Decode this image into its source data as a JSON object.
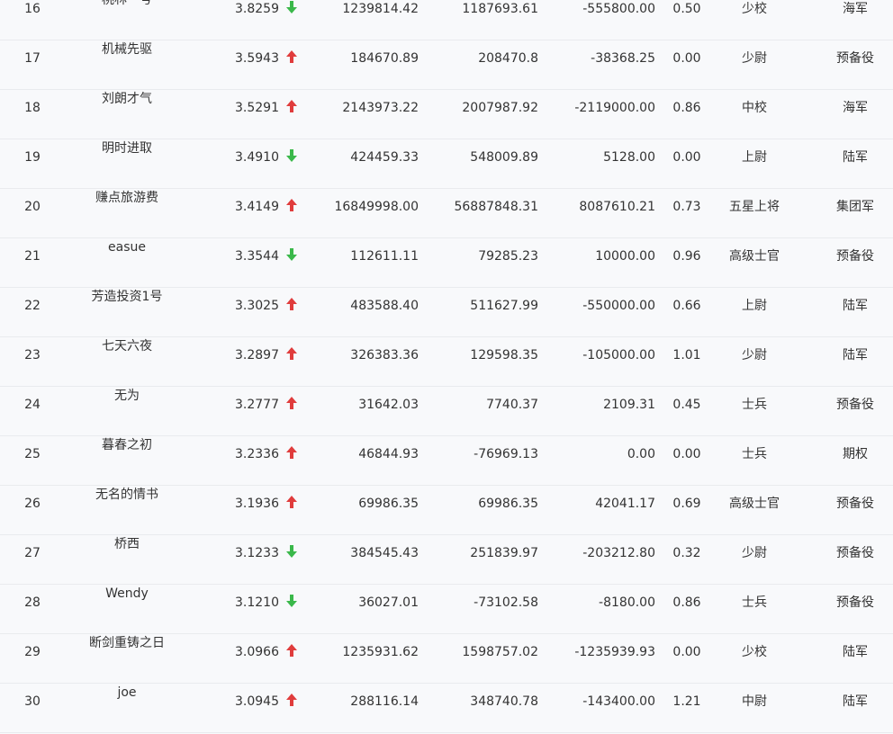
{
  "colors": {
    "up_arrow": "#e03c3c",
    "down_arrow": "#3ab84a",
    "text": "#333333",
    "background": "#f8f9fb"
  },
  "rows": [
    {
      "rank": "16",
      "name": "桃林一号",
      "score": "3.8259",
      "trend": "down",
      "v1": "1239814.42",
      "v2": "1187693.61",
      "v3": "-555800.00",
      "ratio": "0.50",
      "level": "少校",
      "branch": "海军"
    },
    {
      "rank": "17",
      "name": "机械先驱",
      "score": "3.5943",
      "trend": "up",
      "v1": "184670.89",
      "v2": "208470.8",
      "v3": "-38368.25",
      "ratio": "0.00",
      "level": "少尉",
      "branch": "预备役"
    },
    {
      "rank": "18",
      "name": "刘朗才气",
      "score": "3.5291",
      "trend": "up",
      "v1": "2143973.22",
      "v2": "2007987.92",
      "v3": "-2119000.00",
      "ratio": "0.86",
      "level": "中校",
      "branch": "海军"
    },
    {
      "rank": "19",
      "name": "明时进取",
      "score": "3.4910",
      "trend": "down",
      "v1": "424459.33",
      "v2": "548009.89",
      "v3": "5128.00",
      "ratio": "0.00",
      "level": "上尉",
      "branch": "陆军"
    },
    {
      "rank": "20",
      "name": "赚点旅游费",
      "score": "3.4149",
      "trend": "up",
      "v1": "16849998.00",
      "v2": "56887848.31",
      "v3": "8087610.21",
      "ratio": "0.73",
      "level": "五星上将",
      "branch": "集团军"
    },
    {
      "rank": "21",
      "name": "easue",
      "score": "3.3544",
      "trend": "down",
      "v1": "112611.11",
      "v2": "79285.23",
      "v3": "10000.00",
      "ratio": "0.96",
      "level": "高级士官",
      "branch": "预备役"
    },
    {
      "rank": "22",
      "name": "芳造投资1号",
      "score": "3.3025",
      "trend": "up",
      "v1": "483588.40",
      "v2": "511627.99",
      "v3": "-550000.00",
      "ratio": "0.66",
      "level": "上尉",
      "branch": "陆军"
    },
    {
      "rank": "23",
      "name": "七天六夜",
      "score": "3.2897",
      "trend": "up",
      "v1": "326383.36",
      "v2": "129598.35",
      "v3": "-105000.00",
      "ratio": "1.01",
      "level": "少尉",
      "branch": "陆军"
    },
    {
      "rank": "24",
      "name": "无为",
      "score": "3.2777",
      "trend": "up",
      "v1": "31642.03",
      "v2": "7740.37",
      "v3": "2109.31",
      "ratio": "0.45",
      "level": "士兵",
      "branch": "预备役"
    },
    {
      "rank": "25",
      "name": "暮春之初",
      "score": "3.2336",
      "trend": "up",
      "v1": "46844.93",
      "v2": "-76969.13",
      "v3": "0.00",
      "ratio": "0.00",
      "level": "士兵",
      "branch": "期权"
    },
    {
      "rank": "26",
      "name": "无名的情书",
      "score": "3.1936",
      "trend": "up",
      "v1": "69986.35",
      "v2": "69986.35",
      "v3": "42041.17",
      "ratio": "0.69",
      "level": "高级士官",
      "branch": "预备役"
    },
    {
      "rank": "27",
      "name": "桥西",
      "score": "3.1233",
      "trend": "down",
      "v1": "384545.43",
      "v2": "251839.97",
      "v3": "-203212.80",
      "ratio": "0.32",
      "level": "少尉",
      "branch": "预备役"
    },
    {
      "rank": "28",
      "name": "Wendy",
      "score": "3.1210",
      "trend": "down",
      "v1": "36027.01",
      "v2": "-73102.58",
      "v3": "-8180.00",
      "ratio": "0.86",
      "level": "士兵",
      "branch": "预备役"
    },
    {
      "rank": "29",
      "name": "断剑重铸之日",
      "score": "3.0966",
      "trend": "up",
      "v1": "1235931.62",
      "v2": "1598757.02",
      "v3": "-1235939.93",
      "ratio": "0.00",
      "level": "少校",
      "branch": "陆军"
    },
    {
      "rank": "30",
      "name": "joe",
      "score": "3.0945",
      "trend": "up",
      "v1": "288116.14",
      "v2": "348740.78",
      "v3": "-143400.00",
      "ratio": "1.21",
      "level": "中尉",
      "branch": "陆军"
    }
  ]
}
